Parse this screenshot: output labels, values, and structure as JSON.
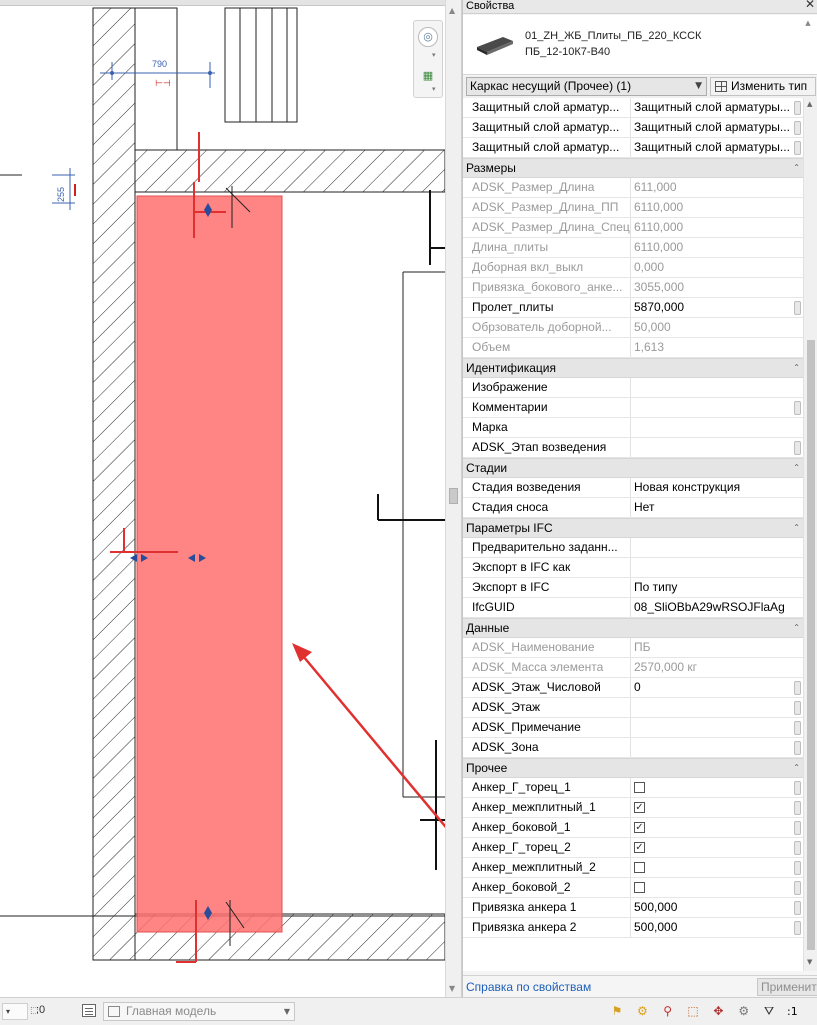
{
  "canvas": {
    "dimension_top": "790",
    "dimension_left": "255",
    "highlight_color": "#ff6f6f",
    "annotation_color": "#e03030"
  },
  "properties": {
    "title": "Свойства",
    "close_icon": "close-icon",
    "type_name_line1": "01_ZH_ЖБ_Плиты_ПБ_220_КССК",
    "type_name_line2": "ПБ_12-10К7-В40",
    "selector_value": "Каркас несущий (Прочее) (1)",
    "edit_type_label": "Изменить тип",
    "rows": [
      {
        "name": "Защитный слой арматур...",
        "value": "Защитный слой арматуры...",
        "disabled": false,
        "button": true
      },
      {
        "name": "Защитный слой арматур...",
        "value": "Защитный слой арматуры...",
        "disabled": false,
        "button": true
      },
      {
        "name": "Защитный слой арматур...",
        "value": "Защитный слой арматуры...",
        "disabled": false,
        "button": true
      },
      {
        "group": "Размеры"
      },
      {
        "name": "ADSK_Размер_Длина",
        "value": "611,000",
        "disabled": true
      },
      {
        "name": "ADSK_Размер_Длина_ПП",
        "value": "6110,000",
        "disabled": true
      },
      {
        "name": "ADSK_Размер_Длина_Спец",
        "value": "6110,000",
        "disabled": true
      },
      {
        "name": "Длина_плиты",
        "value": "6110,000",
        "disabled": true
      },
      {
        "name": "Доборная вкл_выкл",
        "value": "0,000",
        "disabled": true
      },
      {
        "name": "Привязка_бокового_анке...",
        "value": "3055,000",
        "disabled": true
      },
      {
        "name": "Пролет_плиты",
        "value": "5870,000",
        "disabled": false,
        "button": true
      },
      {
        "name": "Обрзователь доборной...",
        "value": "50,000",
        "disabled": true
      },
      {
        "name": "Объем",
        "value": "1,613",
        "disabled": true
      },
      {
        "group": "Идентификация"
      },
      {
        "name": "Изображение",
        "value": "",
        "disabled": false
      },
      {
        "name": "Комментарии",
        "value": "",
        "disabled": false,
        "button": true
      },
      {
        "name": "Марка",
        "value": "",
        "disabled": false
      },
      {
        "name": "ADSK_Этап возведения",
        "value": "",
        "disabled": false,
        "button": true
      },
      {
        "group": "Стадии"
      },
      {
        "name": "Стадия возведения",
        "value": "Новая конструкция",
        "disabled": false
      },
      {
        "name": "Стадия сноса",
        "value": "Нет",
        "disabled": false
      },
      {
        "group": "Параметры IFC"
      },
      {
        "name": "Предварительно заданн...",
        "value": "",
        "disabled": false
      },
      {
        "name": "Экспорт в IFC как",
        "value": "",
        "disabled": false
      },
      {
        "name": "Экспорт в IFC",
        "value": "По типу",
        "disabled": false
      },
      {
        "name": "IfcGUID",
        "value": "08_SliOBbA29wRSOJFlaAg",
        "disabled": false
      },
      {
        "group": "Данные"
      },
      {
        "name": "ADSK_Наименование",
        "value": "ПБ",
        "disabled": true
      },
      {
        "name": "ADSK_Масса элемента",
        "value": "2570,000 кг",
        "disabled": true
      },
      {
        "name": "ADSK_Этаж_Числовой",
        "value": "0",
        "disabled": false,
        "button": true
      },
      {
        "name": "ADSK_Этаж",
        "value": "",
        "disabled": false,
        "button": true
      },
      {
        "name": "ADSK_Примечание",
        "value": "",
        "disabled": false,
        "button": true
      },
      {
        "name": "ADSK_Зона",
        "value": "",
        "disabled": false,
        "button": true
      },
      {
        "group": "Прочее"
      },
      {
        "name": "Анкер_Г_торец_1",
        "check": false,
        "disabled": false,
        "button": true
      },
      {
        "name": "Анкер_межплитный_1",
        "check": true,
        "disabled": false,
        "button": true
      },
      {
        "name": "Анкер_боковой_1",
        "check": true,
        "disabled": false,
        "button": true
      },
      {
        "name": "Анкер_Г_торец_2",
        "check": true,
        "disabled": false,
        "button": true
      },
      {
        "name": "Анкер_межплитный_2",
        "check": false,
        "disabled": false,
        "button": true
      },
      {
        "name": "Анкер_боковой_2",
        "check": false,
        "disabled": false,
        "button": true
      },
      {
        "name": "Привязка анкера 1",
        "value": "500,000",
        "disabled": false,
        "button": true
      },
      {
        "name": "Привязка анкера 2",
        "value": "500,000",
        "disabled": false,
        "button": true
      }
    ],
    "help_link": "Справка по свойствам",
    "apply_label": "Применить"
  },
  "statusbar": {
    "selection_count": ":0",
    "model_name": "Главная модель",
    "icons": [
      "worksharing-icon",
      "link-icon",
      "design-options-icon",
      "select-links-icon",
      "underlay-icon",
      "pinned-icon",
      "drag-icon",
      "filter-icon"
    ],
    "filter_count": ":1"
  }
}
